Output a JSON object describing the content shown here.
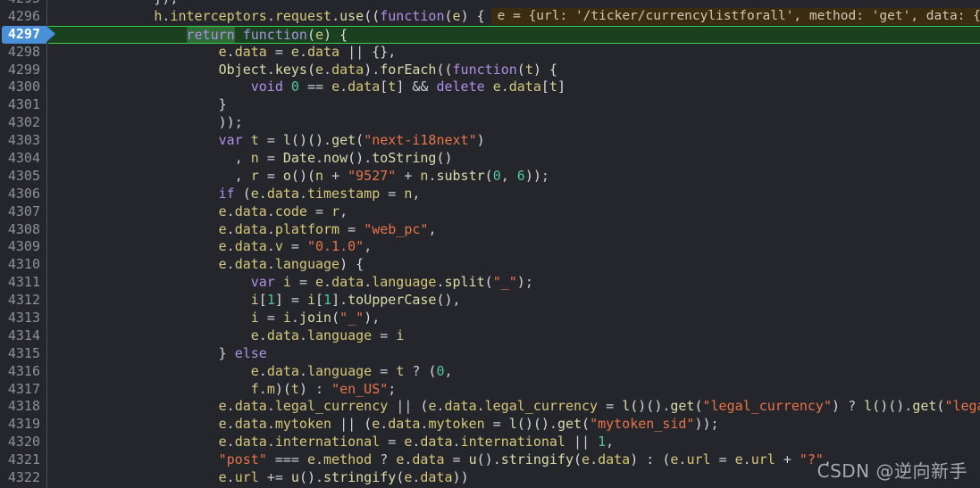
{
  "editor": {
    "theme_background": "#24262b",
    "gutter_border_color": "#4b4f57",
    "line_number_color": "#8b9199",
    "exec_line_background": "#1b4020",
    "exec_line_border": "#3ad14a",
    "exec_pointer_color": "#4a90d9",
    "word_highlight_color": "#2f6b36",
    "inline_hint_background": "#3b2c10",
    "current_line_number": "4297",
    "first_visible_line": "4295",
    "last_visible_line": "4322"
  },
  "inline_hint": {
    "text": "e = {url: '/ticker/currencylistforall', method: 'get', data: {…"
  },
  "watermark": {
    "text": "CSDN @逆向新手"
  },
  "lines": [
    {
      "num": "4295",
      "code": "            }),",
      "partial_top": true
    },
    {
      "num": "4296",
      "code": "            h.interceptors.request.use((function(e) {"
    },
    {
      "num": "4297",
      "code": "                return function(e) {",
      "current": true
    },
    {
      "num": "4298",
      "code": "                    e.data = e.data || {},"
    },
    {
      "num": "4299",
      "code": "                    Object.keys(e.data).forEach((function(t) {"
    },
    {
      "num": "4300",
      "code": "                        void 0 == e.data[t] && delete e.data[t]"
    },
    {
      "num": "4301",
      "code": "                    }"
    },
    {
      "num": "4302",
      "code": "                    ));"
    },
    {
      "num": "4303",
      "code": "                    var t = l()().get(\"next-i18next\")"
    },
    {
      "num": "4304",
      "code": "                      , n = Date.now().toString()"
    },
    {
      "num": "4305",
      "code": "                      , r = o()(n + \"9527\" + n.substr(0, 6));"
    },
    {
      "num": "4306",
      "code": "                    if (e.data.timestamp = n,"
    },
    {
      "num": "4307",
      "code": "                    e.data.code = r,"
    },
    {
      "num": "4308",
      "code": "                    e.data.platform = \"web_pc\","
    },
    {
      "num": "4309",
      "code": "                    e.data.v = \"0.1.0\","
    },
    {
      "num": "4310",
      "code": "                    e.data.language) {"
    },
    {
      "num": "4311",
      "code": "                        var i = e.data.language.split(\"_\");"
    },
    {
      "num": "4312",
      "code": "                        i[1] = i[1].toUpperCase(),"
    },
    {
      "num": "4313",
      "code": "                        i = i.join(\"_\"),"
    },
    {
      "num": "4314",
      "code": "                        e.data.language = i"
    },
    {
      "num": "4315",
      "code": "                    } else"
    },
    {
      "num": "4316",
      "code": "                        e.data.language = t ? (0,"
    },
    {
      "num": "4317",
      "code": "                        f.m)(t) : \"en_US\";"
    },
    {
      "num": "4318",
      "code": "                    e.data.legal_currency || (e.data.legal_currency = l()().get(\"legal_currency\") ? l()().get(\"legal_c"
    },
    {
      "num": "4319",
      "code": "                    e.data.mytoken || (e.data.mytoken = l()().get(\"mytoken_sid\"));"
    },
    {
      "num": "4320",
      "code": "                    e.data.international = e.data.international || 1,"
    },
    {
      "num": "4321",
      "code": "                    \"post\" === e.method ? e.data = u().stringify(e.data) : (e.url = e.url + \"?\","
    },
    {
      "num": "4322",
      "code": "                    e.url += u().stringify(e.data))"
    }
  ]
}
